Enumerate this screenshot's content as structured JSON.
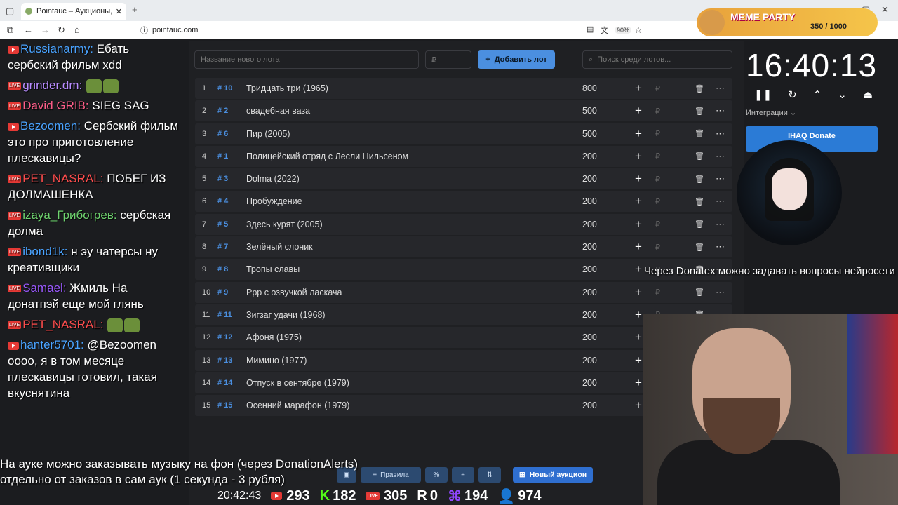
{
  "browser": {
    "tab_title": "Pointauc – Аукционы, лотереи",
    "url": "pointauc.com",
    "zoom": "90%"
  },
  "page": {
    "new_lot_placeholder": "Название нового лота",
    "price_placeholder": "₽",
    "add_lot_label": "Добавить лот",
    "search_placeholder": "Поиск среди лотов...",
    "currency": "₽",
    "lots": [
      {
        "n": "1",
        "id": "# 10",
        "name": "Тридцать три (1965)",
        "amount": "800"
      },
      {
        "n": "2",
        "id": "# 2",
        "name": "свадебная ваза",
        "amount": "500"
      },
      {
        "n": "3",
        "id": "# 6",
        "name": "Пир (2005)",
        "amount": "500"
      },
      {
        "n": "4",
        "id": "# 1",
        "name": "Полицейский отряд с Лесли Нильсеном",
        "amount": "200"
      },
      {
        "n": "5",
        "id": "# 3",
        "name": " Dolma (2022)",
        "amount": "200"
      },
      {
        "n": "6",
        "id": "# 4",
        "name": "Пробуждение",
        "amount": "200"
      },
      {
        "n": "7",
        "id": "# 5",
        "name": "Здесь курят (2005)",
        "amount": "200"
      },
      {
        "n": "8",
        "id": "# 7",
        "name": "Зелёный слоник",
        "amount": "200"
      },
      {
        "n": "9",
        "id": "# 8",
        "name": "Тропы славы",
        "amount": "200"
      },
      {
        "n": "10",
        "id": "# 9",
        "name": "Ррр с озвучкой ласкача",
        "amount": "200"
      },
      {
        "n": "11",
        "id": "# 11",
        "name": "Зигзаг удачи (1968)",
        "amount": "200"
      },
      {
        "n": "12",
        "id": "# 12",
        "name": "Афоня (1975)",
        "amount": "200"
      },
      {
        "n": "13",
        "id": "# 13",
        "name": "Мимино (1977)",
        "amount": "200"
      },
      {
        "n": "14",
        "id": "# 14",
        "name": "Отпуск в сентябре (1979)",
        "amount": "200"
      },
      {
        "n": "15",
        "id": "# 15",
        "name": "Осенний марафон (1979)",
        "amount": "200"
      }
    ],
    "toolbar": {
      "rules_label": "Правила",
      "percent_label": "%",
      "new_auction_label": "Новый аукцион"
    }
  },
  "timer": {
    "time": "16:40:13",
    "integrations_label": "Интеграции",
    "donate_label": "IHAQ Donate"
  },
  "chat": {
    "messages": [
      {
        "user": "Russianarmy:",
        "user_color": "#4aa3ff",
        "text": "Ебать сербский фильм xdd",
        "platform": "youtube"
      },
      {
        "user": "grinder.dm:",
        "user_color": "#b98cff",
        "text": "",
        "platform": "live"
      },
      {
        "user": "David GRIB:",
        "user_color": "#ff5f8a",
        "text": "SIEG SAG",
        "platform": "live"
      },
      {
        "user": "Bezoomen:",
        "user_color": "#4aa3ff",
        "text": "Сербский фильм это про приготовление плескавицы?",
        "platform": "youtube"
      },
      {
        "user": "PET_NASRAL:",
        "user_color": "#ff4d4d",
        "text": "ПОБЕГ ИЗ ДОЛМАШЕНКА",
        "platform": "live"
      },
      {
        "user": "izaya_Грибогрев:",
        "user_color": "#6fd46f",
        "text": "сербская долма",
        "platform": "live"
      },
      {
        "user": "ibond1k:",
        "user_color": "#4aa3ff",
        "text": "н эу чатерсы ну креативщики",
        "platform": "live"
      },
      {
        "user": "Samael:",
        "user_color": "#9b59ff",
        "text": "Жмиль На донатпэй еще мой глянь",
        "platform": "live"
      },
      {
        "user": "PET_NASRAL:",
        "user_color": "#ff4d4d",
        "text": "",
        "platform": "live"
      },
      {
        "user": "hanter5701:",
        "user_color": "#4aa3ff",
        "text": "@Bezoomen оооо, я в том месяце плескавицы готовил, такая вкуснятина",
        "platform": "youtube"
      }
    ]
  },
  "overlay": {
    "ticker": "Через Donatex можно задавать вопросы нейросети",
    "note_line1": "На ауке можно заказывать музыку на фон (через DonationAlerts)",
    "note_line2": "отдельно от заказов в сам аук (1 секунда - 3 рубля)",
    "clock": "20:42:43",
    "stats": {
      "youtube": "293",
      "kick": "182",
      "live": "305",
      "rutube": "0",
      "twitch": "194",
      "viewers": "974"
    },
    "meme_party_title": "MEME PARTY",
    "meme_party_score": "350 / 1000"
  }
}
